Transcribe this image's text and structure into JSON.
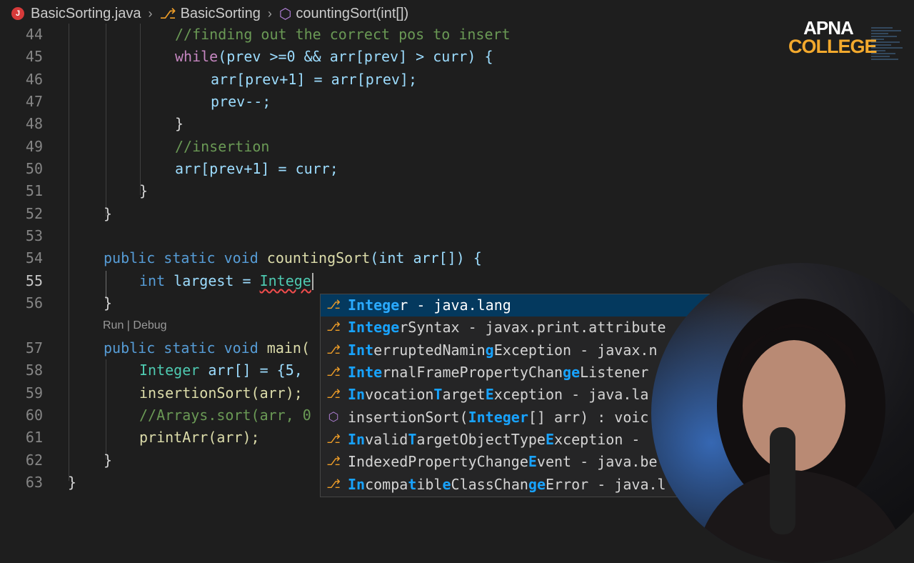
{
  "breadcrumb": {
    "file": "BasicSorting.java",
    "file_badge": "J",
    "class": "BasicSorting",
    "method": "countingSort(int[])"
  },
  "logo": {
    "line1": "APNA",
    "line2": "COLLEGE"
  },
  "line_numbers": [
    "44",
    "45",
    "46",
    "47",
    "48",
    "49",
    "50",
    "51",
    "52",
    "53",
    "54",
    "55",
    "56",
    "",
    "57",
    "58",
    "59",
    "60",
    "61",
    "62",
    "63"
  ],
  "code": {
    "l44": "//finding out the correct pos to insert",
    "l45_kw": "while",
    "l45_rest": "(prev >=0 && arr[prev] > curr) {",
    "l46": "arr[prev+1] = arr[prev];",
    "l47": "prev--;",
    "l48": "}",
    "l49": "//insertion",
    "l50": "arr[prev+1] = curr;",
    "l51": "}",
    "l52": "}",
    "l54_mods": "public static void",
    "l54_fn": "countingSort",
    "l54_rest": "(int arr[]) {",
    "l55_type": "int",
    "l55_var": "largest = ",
    "l55_typed": "Intege",
    "l56": "}",
    "codelens": "Run | Debug",
    "l57_mods": "public static void",
    "l57_fn": "main(",
    "l58_type": "Integer",
    "l58_rest": "arr[] = {5,",
    "l59": "insertionSort(arr);",
    "l60": "//Arrays.sort(arr, 0",
    "l61": "printArr(arr);",
    "l62": "}",
    "l63": "}"
  },
  "suggestions": [
    {
      "kind": "class",
      "parts": [
        [
          "Intege",
          true
        ],
        [
          "r - java.lang",
          false
        ]
      ]
    },
    {
      "kind": "class",
      "parts": [
        [
          "Intege",
          true
        ],
        [
          "rSyntax - javax.print.attribute",
          false
        ]
      ]
    },
    {
      "kind": "class",
      "parts": [
        [
          "Int",
          true
        ],
        [
          "erruptedNamin",
          false
        ],
        [
          "g",
          true
        ],
        [
          "Exception - javax.n",
          false
        ]
      ]
    },
    {
      "kind": "class",
      "parts": [
        [
          "Inte",
          true
        ],
        [
          "rnalFramePropertyChan",
          false
        ],
        [
          "ge",
          true
        ],
        [
          "Listener",
          false
        ]
      ]
    },
    {
      "kind": "class",
      "parts": [
        [
          "In",
          true
        ],
        [
          "vocation",
          false
        ],
        [
          "T",
          true
        ],
        [
          "arget",
          false
        ],
        [
          "E",
          true
        ],
        [
          "xception - java.la",
          false
        ]
      ]
    },
    {
      "kind": "method",
      "parts": [
        [
          "insertionSort(",
          false
        ],
        [
          "Integer",
          true
        ],
        [
          "[] arr) : voic",
          false
        ]
      ]
    },
    {
      "kind": "class",
      "parts": [
        [
          "In",
          true
        ],
        [
          "valid",
          false
        ],
        [
          "T",
          true
        ],
        [
          "argetObjectType",
          false
        ],
        [
          "E",
          true
        ],
        [
          "xception -",
          false
        ]
      ]
    },
    {
      "kind": "class",
      "parts": [
        [
          "IndexedPropertyChange",
          false
        ],
        [
          "E",
          true
        ],
        [
          "vent - java.be",
          false
        ]
      ]
    },
    {
      "kind": "class",
      "parts": [
        [
          "In",
          true
        ],
        [
          "compa",
          false
        ],
        [
          "t",
          true
        ],
        [
          "ibl",
          false
        ],
        [
          "e",
          true
        ],
        [
          "ClassChan",
          false
        ],
        [
          "ge",
          true
        ],
        [
          "Error - java.l",
          false
        ]
      ]
    }
  ]
}
